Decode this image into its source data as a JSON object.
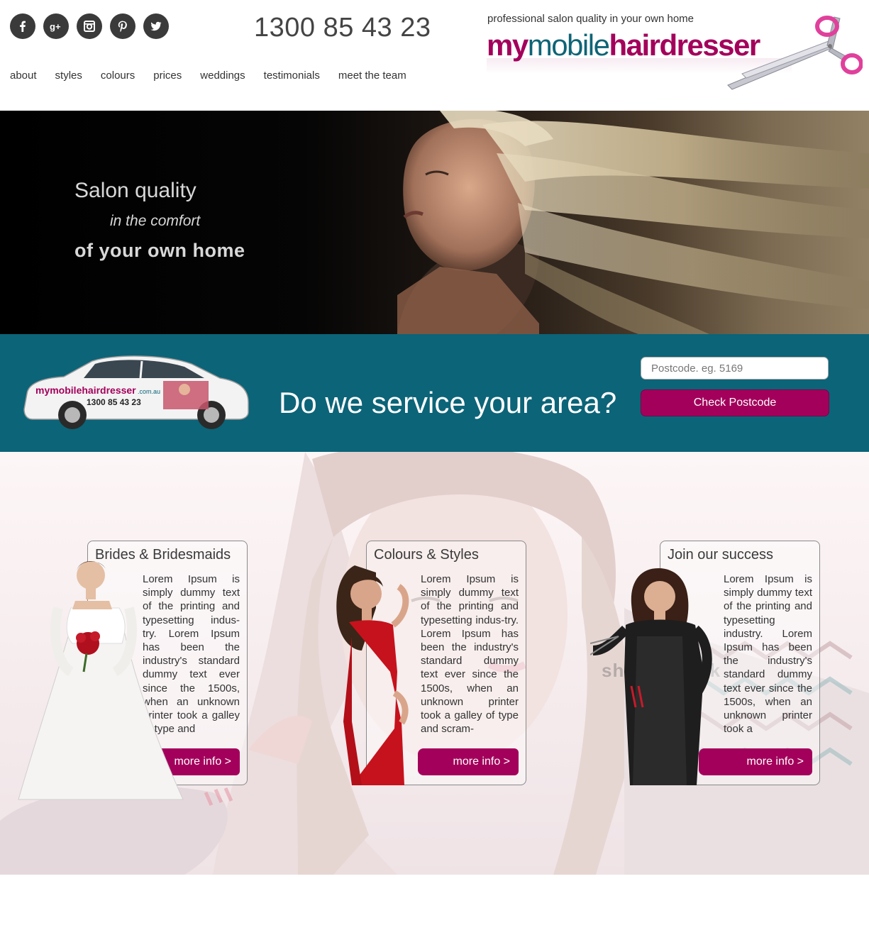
{
  "header": {
    "social": [
      {
        "name": "facebook-icon"
      },
      {
        "name": "google-plus-icon"
      },
      {
        "name": "instagram-icon"
      },
      {
        "name": "pinterest-icon"
      },
      {
        "name": "twitter-icon"
      }
    ],
    "phone": "1300 85 43 23",
    "nav": [
      "about",
      "styles",
      "colours",
      "prices",
      "weddings",
      "testimonials",
      "meet the team"
    ],
    "logo": {
      "tagline": "professional salon quality in your own home",
      "word_my": "my",
      "word_mobile": "mobile",
      "word_hairdresser": "hairdresser"
    }
  },
  "hero": {
    "line1": "Salon quality",
    "line2": "in the comfort",
    "line3": "of your own home"
  },
  "area": {
    "car_brand": "mymobilehairdresser",
    "car_brand_suffix": ".com.au",
    "car_phone": "1300 85 43 23",
    "question": "Do we service your area?",
    "postcode_placeholder": "Postcode. eg. 5169",
    "postcode_value": "",
    "button": "Check Postcode"
  },
  "cards": [
    {
      "title": "Brides & Bridesmaids",
      "body": "Lorem Ipsum is simply dummy text of the printing and typesetting indus-try. Lorem Ipsum has been the industry's standard dummy text ever since the 1500s, when an unknown printer took a galley of type and",
      "button": "more info >"
    },
    {
      "title": "Colours & Styles",
      "body": "Lorem Ipsum is simply dummy text of the printing and typesetting indus-try. Lorem Ipsum has been the industry's standard dummy text ever since the 1500s, when an unknown printer took a galley of type and scram-",
      "button": "more info >"
    },
    {
      "title": "Join our success",
      "body": "Lorem Ipsum is simply dummy text of the printing and typesetting industry. Lorem Ipsum has been the industry's standard dummy text ever since the 1500s, when an unknown printer took a",
      "button": "more info >"
    }
  ],
  "watermark": "shutterstock",
  "colors": {
    "brand_magenta": "#a3005b",
    "brand_teal": "#0c6478",
    "icon_dark": "#3a3a3a"
  }
}
